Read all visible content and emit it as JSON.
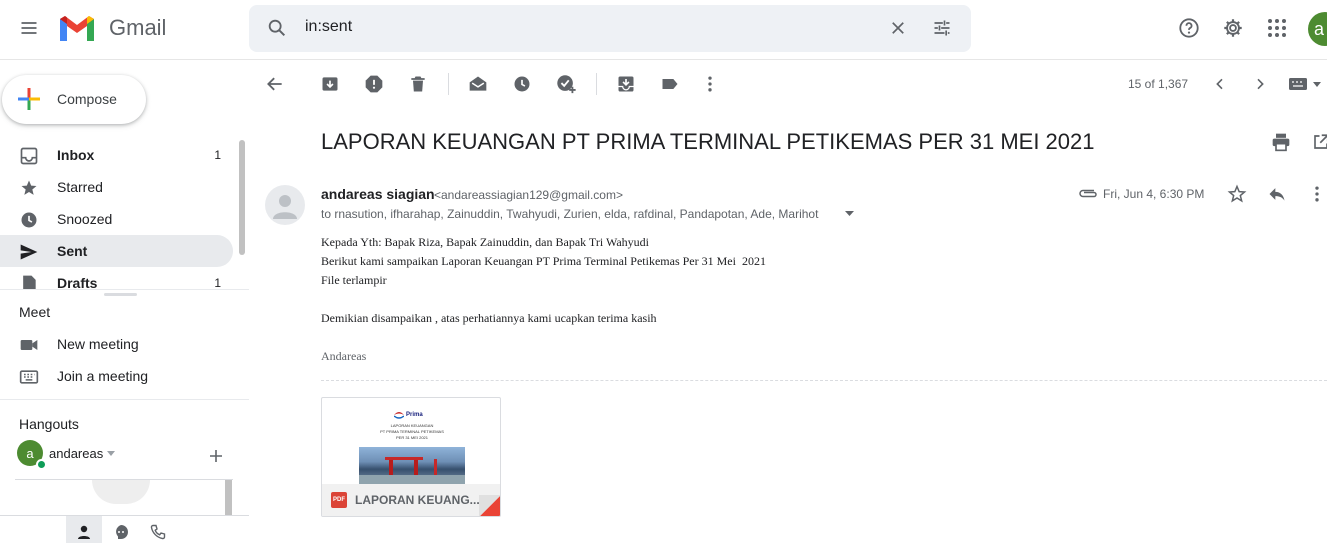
{
  "app": {
    "name": "Gmail"
  },
  "colors": {
    "accent_red": "#ea4335",
    "active_bg": "#e8eaed",
    "avatar_green": "#4d8b31",
    "status_green": "#0f9d58"
  },
  "search": {
    "value": "in:sent"
  },
  "user": {
    "initial": "a"
  },
  "compose": {
    "label": "Compose"
  },
  "nav": {
    "items": [
      {
        "label": "Inbox",
        "count": "1",
        "icon": "inbox-icon"
      },
      {
        "label": "Starred",
        "count": "",
        "icon": "star-icon"
      },
      {
        "label": "Snoozed",
        "count": "",
        "icon": "clock-icon"
      },
      {
        "label": "Sent",
        "count": "",
        "icon": "send-icon"
      },
      {
        "label": "Drafts",
        "count": "1",
        "icon": "draft-icon"
      }
    ]
  },
  "meet": {
    "heading": "Meet",
    "new_meeting": "New meeting",
    "join_meeting": "Join a meeting"
  },
  "hangouts": {
    "heading": "Hangouts",
    "user_name": "andareas",
    "user_initial": "a"
  },
  "toolbar": {
    "page_count": "15 of 1,367"
  },
  "message": {
    "subject": "LAPORAN KEUANGAN PT PRIMA TERMINAL PETIKEMAS PER 31 MEI 2021",
    "sender_name": "andareas siagian",
    "sender_email": "<andareassiagian129@gmail.com>",
    "recipients": "to rnasution, ifharahap, Zainuddin, Twahyudi, Zurien, elda, rafdinal, Pandapotan, Ade, Marihot",
    "date": "Fri, Jun 4, 6:30 PM",
    "body": [
      "Kepada Yth: Bapak Riza, Bapak Zainuddin, dan Bapak Tri Wahyudi",
      "Berikut kami sampaikan Laporan Keuangan PT Prima Terminal Petikemas Per 31 Mei  2021",
      "File terlampir",
      "Demikian disampaikan , atas perhatiannya kami ucapkan terima kasih"
    ],
    "signature": "Andareas"
  },
  "attachment": {
    "name": "LAPORAN KEUANG...",
    "badge": "PDF",
    "preview_brand": "Prima",
    "preview_lines": [
      "LAPORAN KEUANGAN",
      "PT PRIMA TERMINAL PETIKEMAS",
      "PER 31 MEI 2021"
    ]
  }
}
